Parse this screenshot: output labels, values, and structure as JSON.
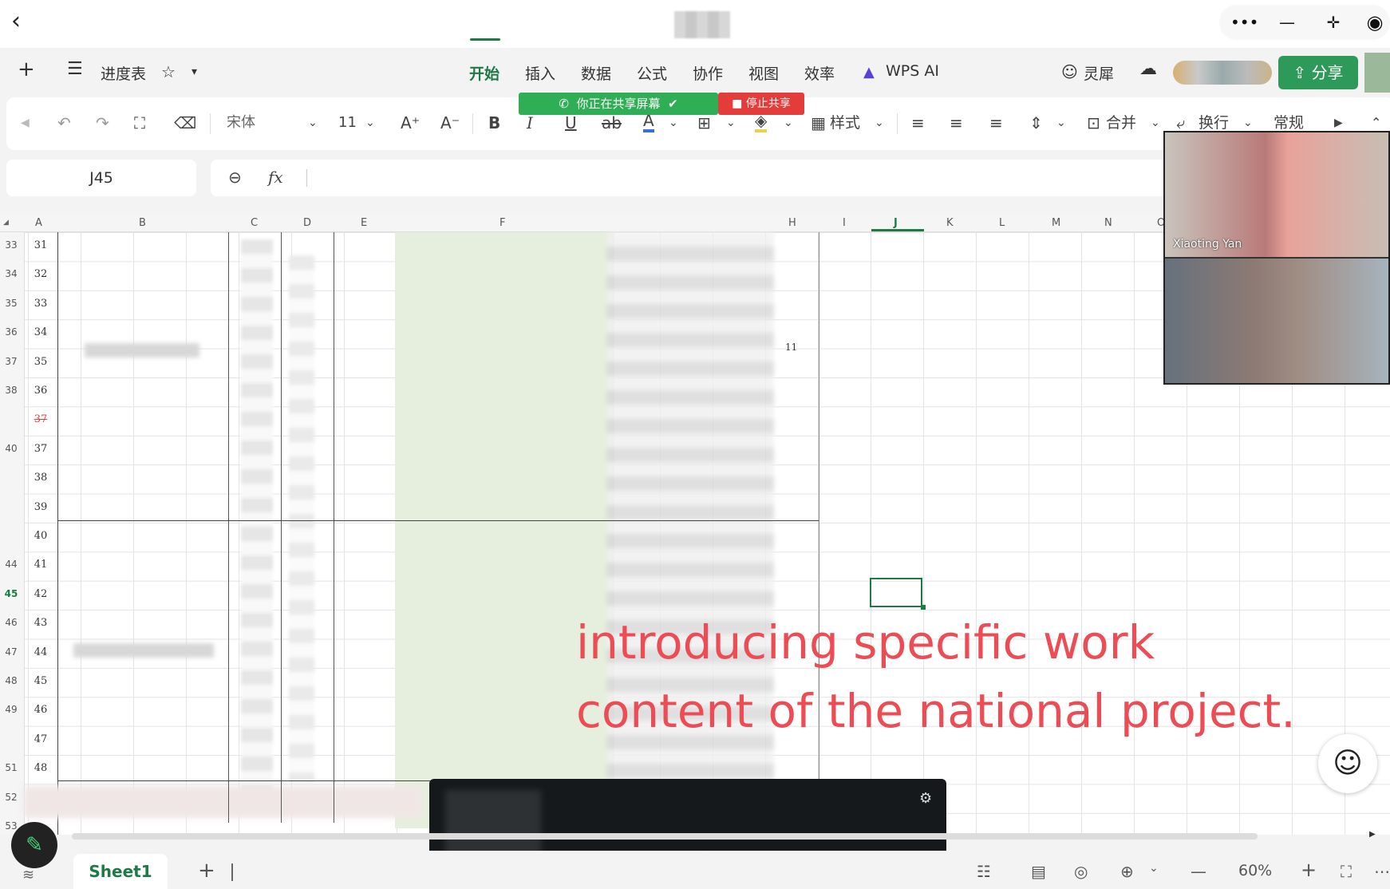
{
  "window": {
    "back_icon": "chevron-left-icon",
    "controls": [
      "more-icon",
      "minimize-icon",
      "shrink-icon",
      "record-icon"
    ]
  },
  "doc": {
    "title": "进度表",
    "add_label": "+",
    "menu_icon": "hamburger-icon"
  },
  "ribbon": {
    "tabs": [
      "开始",
      "插入",
      "数据",
      "公式",
      "协作",
      "视图",
      "效率",
      "WPS AI"
    ],
    "active_tab": "开始",
    "right": {
      "lingxi": "灵犀",
      "share": "分享"
    }
  },
  "toolbar": {
    "font_name": "宋体",
    "font_size": "11",
    "style_label": "样式",
    "merge_label": "合并",
    "wrap_label": "换行",
    "format_label": "常规"
  },
  "screen_share": {
    "status": "你正在共享屏幕",
    "stop": "停止共享"
  },
  "formula": {
    "cell_ref": "J45",
    "fx": "fx"
  },
  "grid": {
    "columns": [
      "A",
      "B",
      "C",
      "D",
      "E",
      "F",
      "H",
      "I",
      "J",
      "K",
      "L",
      "M",
      "N",
      "O"
    ],
    "row_headers": [
      "33",
      "34",
      "35",
      "36",
      "37",
      "38",
      "",
      "40",
      "",
      "",
      "",
      "44",
      "45",
      "46",
      "47",
      "48",
      "49",
      "",
      "51",
      "52",
      "53"
    ],
    "row_numbers": [
      "31",
      "32",
      "33",
      "34",
      "35",
      "36",
      "37",
      "37",
      "38",
      "39",
      "40",
      "41",
      "42",
      "43",
      "44",
      "45",
      "46",
      "47",
      "48"
    ],
    "h_value": "11"
  },
  "video": {
    "participant": "Xiaoting Yan"
  },
  "caption": {
    "line1": "introducing specific work",
    "line2": "content of the national project."
  },
  "sheets": {
    "active": "Sheet1"
  },
  "status": {
    "zoom": "60%"
  }
}
